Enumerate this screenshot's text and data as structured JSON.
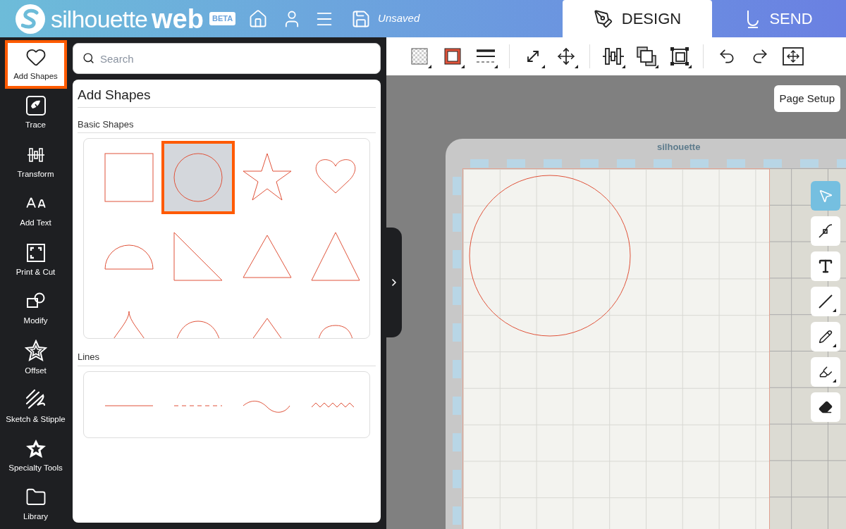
{
  "header": {
    "brand_light": "silhouette",
    "brand_bold": "web",
    "badge": "BETA",
    "file_status": "Unsaved",
    "tabs": [
      {
        "label": "DESIGN",
        "kind": "design",
        "selected": true
      },
      {
        "label": "SEND",
        "kind": "send",
        "selected": false
      }
    ]
  },
  "sidebar": {
    "items": [
      {
        "label": "Add Shapes",
        "kind": "shapes",
        "selected": true
      },
      {
        "label": "Trace",
        "kind": "trace",
        "selected": false
      },
      {
        "label": "Transform",
        "kind": "transform",
        "selected": false
      },
      {
        "label": "Add Text",
        "kind": "text",
        "selected": false
      },
      {
        "label": "Print & Cut",
        "kind": "printcut",
        "selected": false
      },
      {
        "label": "Modify",
        "kind": "modify",
        "selected": false
      },
      {
        "label": "Offset",
        "kind": "offset",
        "selected": false
      },
      {
        "label": "Sketch & Stipple",
        "kind": "sketch",
        "selected": false
      },
      {
        "label": "Specialty Tools",
        "kind": "specialty",
        "selected": false
      },
      {
        "label": "Library",
        "kind": "library",
        "selected": false
      }
    ]
  },
  "search": {
    "placeholder": "Search"
  },
  "panel": {
    "title": "Add Shapes",
    "sections": [
      {
        "title": "Basic Shapes",
        "items": [
          {
            "kind": "square",
            "selected": false
          },
          {
            "kind": "circle",
            "selected": true
          },
          {
            "kind": "star",
            "selected": false
          },
          {
            "kind": "heart",
            "selected": false
          },
          {
            "kind": "semicircle",
            "selected": false
          },
          {
            "kind": "right-triangle",
            "selected": false
          },
          {
            "kind": "triangle",
            "selected": false
          },
          {
            "kind": "tall-triangle",
            "selected": false
          },
          {
            "kind": "drop",
            "selected": false
          },
          {
            "kind": "arch",
            "selected": false
          },
          {
            "kind": "kite",
            "selected": false
          },
          {
            "kind": "bump",
            "selected": false
          }
        ]
      },
      {
        "title": "Lines",
        "items": [
          {
            "kind": "line",
            "selected": false
          },
          {
            "kind": "dashed-line",
            "selected": false
          },
          {
            "kind": "wave",
            "selected": false
          },
          {
            "kind": "zigzag",
            "selected": false
          }
        ]
      }
    ]
  },
  "toolbar": {
    "groups": [
      [
        {
          "kind": "fill",
          "dropdown": true
        },
        {
          "kind": "stroke",
          "dropdown": true
        },
        {
          "kind": "line-style",
          "dropdown": true
        }
      ],
      [
        {
          "kind": "resize",
          "dropdown": true
        },
        {
          "kind": "move",
          "dropdown": true
        }
      ],
      [
        {
          "kind": "align",
          "dropdown": true
        },
        {
          "kind": "arrange",
          "dropdown": true
        },
        {
          "kind": "group",
          "dropdown": true
        }
      ],
      [
        {
          "kind": "undo",
          "dropdown": false
        },
        {
          "kind": "redo",
          "dropdown": false
        },
        {
          "kind": "fit",
          "dropdown": false
        }
      ]
    ]
  },
  "page_setup": "Page Setup",
  "mat": {
    "logo": "silhouette"
  },
  "canvas_tools": [
    {
      "kind": "select",
      "selected": true,
      "dropdown": false
    },
    {
      "kind": "edit-points",
      "selected": false,
      "dropdown": false
    },
    {
      "kind": "text",
      "selected": false,
      "dropdown": false
    },
    {
      "kind": "line",
      "selected": false,
      "dropdown": true
    },
    {
      "kind": "pencil",
      "selected": false,
      "dropdown": true
    },
    {
      "kind": "marker",
      "selected": false,
      "dropdown": true
    },
    {
      "kind": "eraser",
      "selected": false,
      "dropdown": false
    }
  ]
}
